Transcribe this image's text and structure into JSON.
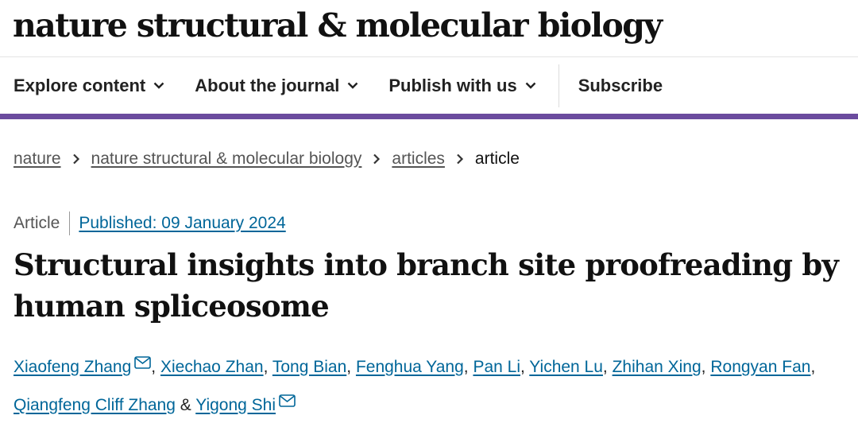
{
  "journal": {
    "name": "nature structural & molecular biology"
  },
  "nav": {
    "items": [
      {
        "label": "Explore content",
        "icon": "chevron-down-icon"
      },
      {
        "label": "About the journal",
        "icon": "chevron-down-icon"
      },
      {
        "label": "Publish with us",
        "icon": "chevron-down-icon"
      }
    ],
    "subscribe_label": "Subscribe",
    "accent_color": "#6b4b9e"
  },
  "breadcrumb": {
    "items": [
      "nature",
      "nature structural & molecular biology",
      "articles"
    ],
    "current": "article"
  },
  "article": {
    "type": "Article",
    "published": "Published: 09 January 2024",
    "title": "Structural insights into branch site proofreading by human spliceosome",
    "authors": [
      "Xiaofeng Zhang",
      "Xiechao Zhan",
      "Tong Bian",
      "Fenghua Yang",
      "Pan Li",
      "Yichen Lu",
      "Zhihan Xing",
      "Rongyan Fan",
      "Qiangfeng Cliff Zhang",
      "Yigong Shi"
    ],
    "author_separators": [
      ", ",
      ", ",
      ", ",
      ", ",
      ", ",
      ", ",
      ", ",
      ", ",
      " & "
    ],
    "link_color": "#006699"
  }
}
